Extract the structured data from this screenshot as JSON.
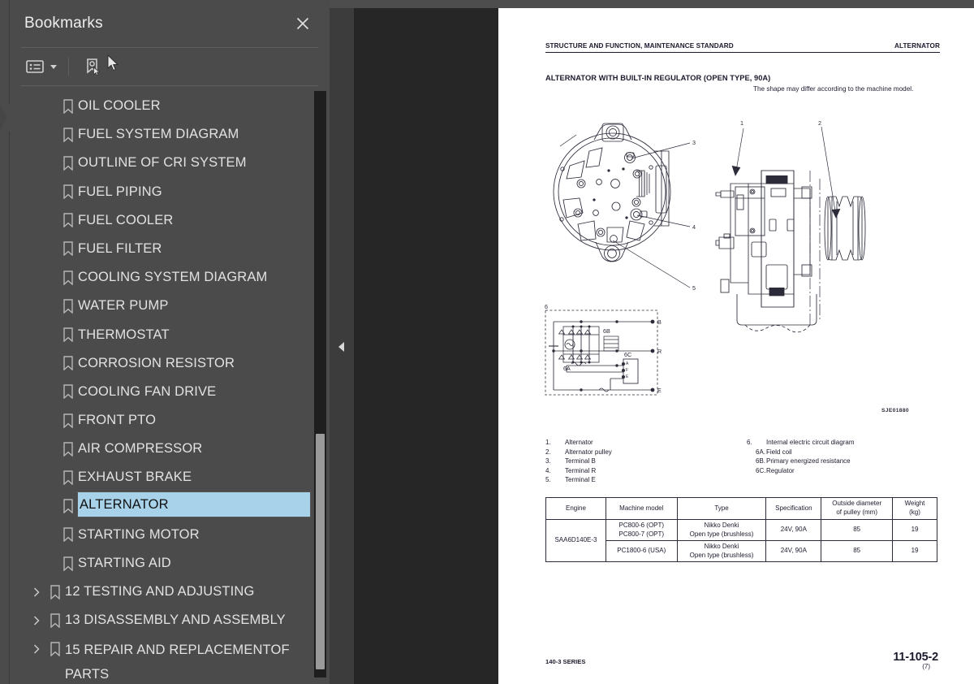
{
  "panel": {
    "title": "Bookmarks",
    "close_icon": "close-icon",
    "toolbar": {
      "list_options_icon": "list-options-icon",
      "dropdown_caret_icon": "chevron-down-icon",
      "new_bookmark_icon": "new-bookmark-icon",
      "cursor_icon": "mouse-pointer-icon"
    },
    "bookmarks": [
      {
        "label": "OIL COOLER",
        "level": 2,
        "expandable": false,
        "selected": false
      },
      {
        "label": "FUEL SYSTEM DIAGRAM",
        "level": 2,
        "expandable": false,
        "selected": false
      },
      {
        "label": "OUTLINE OF CRI SYSTEM",
        "level": 2,
        "expandable": false,
        "selected": false
      },
      {
        "label": "FUEL PIPING",
        "level": 2,
        "expandable": false,
        "selected": false
      },
      {
        "label": "FUEL COOLER",
        "level": 2,
        "expandable": false,
        "selected": false
      },
      {
        "label": "FUEL FILTER",
        "level": 2,
        "expandable": false,
        "selected": false
      },
      {
        "label": "COOLING SYSTEM DIAGRAM",
        "level": 2,
        "expandable": false,
        "selected": false
      },
      {
        "label": "WATER PUMP",
        "level": 2,
        "expandable": false,
        "selected": false
      },
      {
        "label": "THERMOSTAT",
        "level": 2,
        "expandable": false,
        "selected": false
      },
      {
        "label": "CORROSION RESISTOR",
        "level": 2,
        "expandable": false,
        "selected": false
      },
      {
        "label": "COOLING FAN DRIVE",
        "level": 2,
        "expandable": false,
        "selected": false
      },
      {
        "label": "FRONT PTO",
        "level": 2,
        "expandable": false,
        "selected": false
      },
      {
        "label": "AIR COMPRESSOR",
        "level": 2,
        "expandable": false,
        "selected": false
      },
      {
        "label": "EXHAUST BRAKE",
        "level": 2,
        "expandable": false,
        "selected": false
      },
      {
        "label": "ALTERNATOR",
        "level": 2,
        "expandable": false,
        "selected": true
      },
      {
        "label": "STARTING MOTOR",
        "level": 2,
        "expandable": false,
        "selected": false
      },
      {
        "label": "STARTING AID",
        "level": 2,
        "expandable": false,
        "selected": false
      },
      {
        "label": "12 TESTING AND ADJUSTING",
        "level": 1,
        "expandable": true,
        "selected": false
      },
      {
        "label": "13 DISASSEMBLY AND ASSEMBLY",
        "level": 1,
        "expandable": true,
        "selected": false
      },
      {
        "label": "15 REPAIR AND REPLACEMENTOF\nPARTS",
        "level": 1,
        "expandable": true,
        "selected": false
      }
    ]
  },
  "viewer": {
    "collapse_arrow_icon": "chevron-left-icon"
  },
  "document": {
    "header_left": "STRUCTURE AND FUNCTION, MAINTENANCE STANDARD",
    "header_right": "ALTERNATOR",
    "title": "ALTERNATOR WITH BUILT-IN REGULATOR (OPEN TYPE, 90A)",
    "note": "The shape may differ according to the machine model.",
    "drawing_number": "SJE01880",
    "callouts": [
      "1",
      "2",
      "3",
      "4",
      "5",
      "6",
      "6A",
      "6B",
      "6C",
      "B",
      "R",
      "E"
    ],
    "legend_left": [
      {
        "num": "1.",
        "text": "Alternator"
      },
      {
        "num": "2.",
        "text": "Alternator pulley"
      },
      {
        "num": "3.",
        "text": "Terminal B"
      },
      {
        "num": "4.",
        "text": "Terminal R"
      },
      {
        "num": "5.",
        "text": "Terminal E"
      }
    ],
    "legend_right": [
      {
        "num": "6.",
        "text": "Internal electric circuit diagram",
        "sub": false
      },
      {
        "num": "6A.",
        "text": "Field coil",
        "sub": true
      },
      {
        "num": "6B.",
        "text": "Primary energized resistance",
        "sub": true
      },
      {
        "num": "6C.",
        "text": "Regulator",
        "sub": true
      }
    ],
    "table": {
      "columns": [
        "Engine",
        "Machine model",
        "Type",
        "Specification",
        "Outside diameter\nof pulley (mm)",
        "Weight\n(kg)"
      ],
      "rows": [
        {
          "engine": "SAA6D140E-3",
          "machine_model": "PC800-6 (OPT)\nPC800-7 (OPT)",
          "type": "Nikko Denki\nOpen type (brushless)",
          "specification": "24V, 90A",
          "pulley_diameter": "85",
          "weight": "19"
        },
        {
          "engine": "",
          "machine_model": "PC1800-6 (USA)",
          "type": "Nikko Denki\nOpen type (brushless)",
          "specification": "24V, 90A",
          "pulley_diameter": "85",
          "weight": "19"
        }
      ]
    },
    "footer_left": "140-3 SERIES",
    "footer_page": "11-105-2",
    "footer_sub": "(7)"
  },
  "colors": {
    "panel_bg": "#4b4b4b",
    "viewer_bg": "#262626",
    "selection": "#a8d2ea",
    "page_bg": "#ffffff",
    "text": "#e2e2e2",
    "doc_text": "#1b1b2e"
  }
}
